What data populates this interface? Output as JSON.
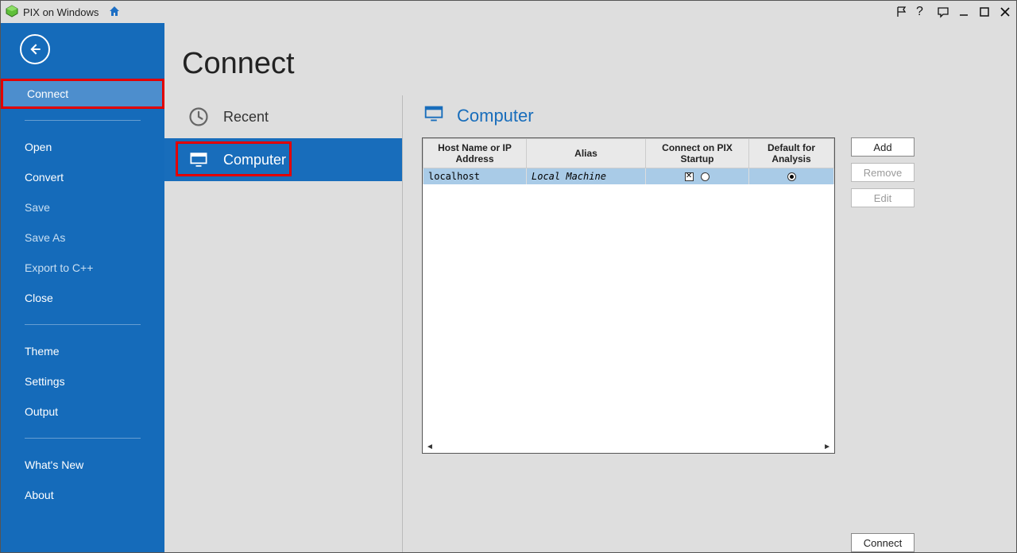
{
  "title": "PIX on Windows",
  "sidebar": {
    "items": [
      {
        "label": "Connect",
        "selected": true,
        "dim": false,
        "highlight": true
      },
      {
        "label": "Open",
        "selected": false,
        "dim": false
      },
      {
        "label": "Convert",
        "selected": false,
        "dim": false
      },
      {
        "label": "Save",
        "selected": false,
        "dim": true
      },
      {
        "label": "Save As",
        "selected": false,
        "dim": true
      },
      {
        "label": "Export to C++",
        "selected": false,
        "dim": true
      },
      {
        "label": "Close",
        "selected": false,
        "dim": false
      },
      {
        "label": "Theme",
        "selected": false,
        "dim": false
      },
      {
        "label": "Settings",
        "selected": false,
        "dim": false
      },
      {
        "label": "Output",
        "selected": false,
        "dim": false
      },
      {
        "label": "What's New",
        "selected": false,
        "dim": false
      },
      {
        "label": "About",
        "selected": false,
        "dim": false
      }
    ]
  },
  "page": {
    "title": "Connect"
  },
  "nav": {
    "recent": {
      "label": "Recent"
    },
    "computer": {
      "label": "Computer"
    }
  },
  "detail": {
    "title": "Computer",
    "columns": {
      "host": "Host Name or IP Address",
      "alias": "Alias",
      "connect_on_startup": "Connect on PIX Startup",
      "default_analysis": "Default for Analysis"
    },
    "rows": [
      {
        "host": "localhost",
        "alias": "Local Machine",
        "startup_checked": true,
        "startup_radio": false,
        "default_analysis": true
      }
    ],
    "buttons": {
      "add": "Add",
      "remove": "Remove",
      "edit": "Edit",
      "connect": "Connect"
    }
  }
}
